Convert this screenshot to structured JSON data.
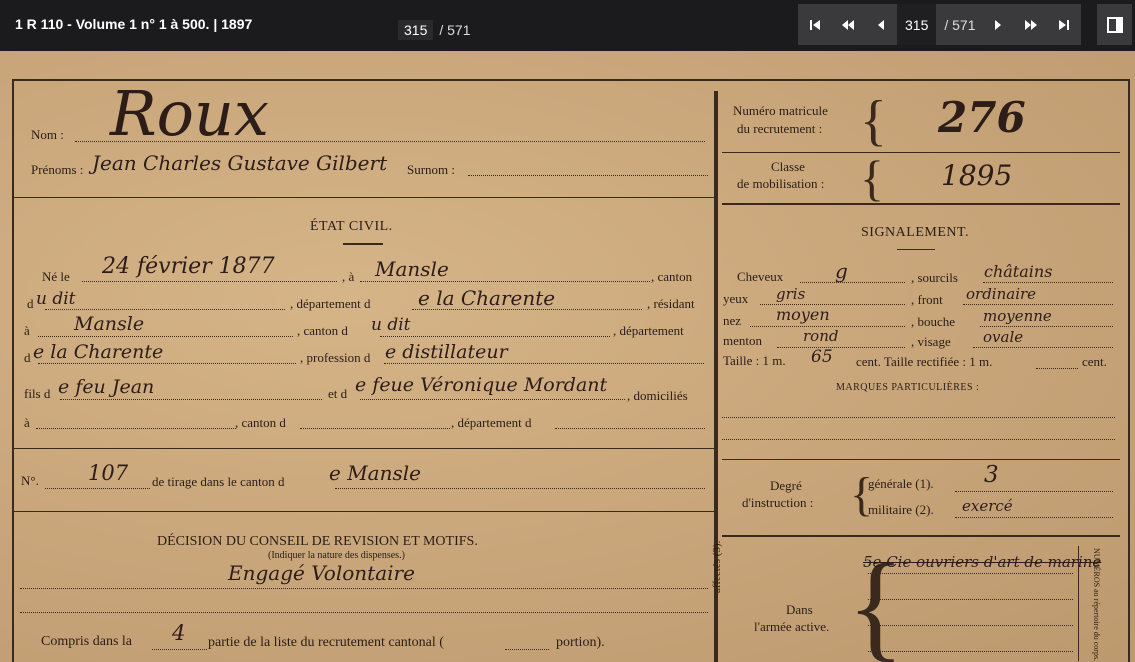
{
  "header": {
    "title": "1 R 110 - Volume 1 n° 1 à 500. | 1897",
    "page_current": "315",
    "page_sep_total": "/ 571"
  },
  "nav": {
    "page_current": "315",
    "page_total": "/ 571",
    "icons": [
      "first-page-icon",
      "fast-back-icon",
      "prev-page-icon",
      "next-page-icon",
      "fast-forward-icon",
      "last-page-icon",
      "side-panel-icon"
    ]
  },
  "form": {
    "nom_label": "Nom :",
    "nom_value": "Roux",
    "prenoms_label": "Prénoms :",
    "prenoms_value": "Jean Charles Gustave Gilbert",
    "surnom_label": "Surnom :",
    "etat_civil": "ÉTAT CIVIL.",
    "ne_le": "Né le",
    "birth_date": "24 février  1877",
    "a": ", à",
    "birth_place": "Mansle",
    "canton": ", canton",
    "du": "d",
    "du_value": "u dit",
    "departement_de": ", département d",
    "departement_value": "e la Charente",
    "residant": ", résidant",
    "a2": "à",
    "residence": "Mansle",
    "canton_du": ", canton d",
    "canton_du_value": "u dit",
    "departement": ", département",
    "d_label": "d",
    "d_value": "e la Charente",
    "profession_label": ", profession d",
    "profession_value": "e distillateur",
    "fils_de": "fils d",
    "father": "e feu Jean",
    "et_de": "et d",
    "mother": "e feue Véronique Mordant",
    "domicilies": ", domiciliés",
    "a3": "à",
    "canton_d": ", canton d",
    "departement_d": ", département d",
    "numero": "N°.",
    "numero_value": "107",
    "tirage": "de tirage dans le canton d",
    "tirage_value": "e Mansle",
    "decision_title": "DÉCISION DU CONSEIL DE REVISION ET MOTIFS.",
    "decision_sub": "(Indiquer la nature des dispenses.)",
    "decision_value": "Engagé Volontaire",
    "compris": "Compris dans la",
    "compris_value": "4",
    "compris_rest": "partie de la liste du recrutement cantonal (",
    "portion": "portion)."
  },
  "right": {
    "matricule_label_1": "Numéro matricule",
    "matricule_label_2": "du recrutement :",
    "matricule_value": "276",
    "classe_label_1": "Classe",
    "classe_label_2": "de mobilisation :",
    "classe_value": "1895",
    "signalement": "SIGNALEMENT.",
    "cheveux": "Cheveux",
    "cheveux_value": "g",
    "sourcils": ", sourcils",
    "sourcils_value": "châtains",
    "yeux": "yeux",
    "yeux_value": "gris",
    "front": ", front",
    "front_value": "ordinaire",
    "nez": "nez",
    "nez_value": "moyen",
    "bouche": ", bouche",
    "bouche_value": "moyenne",
    "menton": "menton",
    "menton_value": "rond",
    "visage": ", visage",
    "visage_value": "ovale",
    "taille": "Taille : 1 m.",
    "taille_value": "65",
    "taille_rect": "cent. Taille rectifiée : 1 m.",
    "cent": "cent.",
    "marques": "MARQUES PARTICULIÈRES :",
    "degre_1": "Degré",
    "degre_2": "d'instruction :",
    "generale": "générale (1).",
    "generale_value": "3",
    "militaire": "militaire (2).",
    "militaire_value": "exercé",
    "affectes": "affectés (3).",
    "armee_1": "Dans",
    "armee_2": "l'armée active.",
    "armee_value": "5e Cie ouvriers d'art de marine",
    "side_text": "NUMÉROS au répertoire du corps."
  }
}
